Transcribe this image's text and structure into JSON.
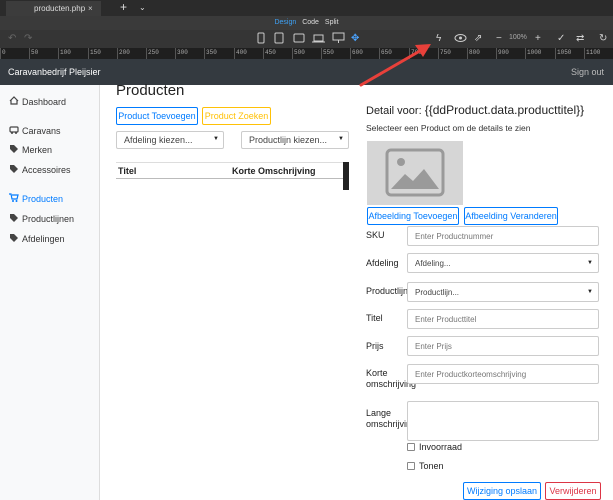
{
  "tabbar": {
    "tab_label": "producten.php",
    "close": "×",
    "add": "+",
    "chevron": "⌄"
  },
  "modebar": {
    "design": "Design",
    "code": "Code",
    "split": "Split"
  },
  "toolbar": {
    "zoom": "100%"
  },
  "ruler": {
    "labels": [
      "0",
      "50",
      "100",
      "150",
      "200",
      "250",
      "300",
      "350",
      "400",
      "450",
      "500",
      "550",
      "600",
      "650",
      "700",
      "750",
      "800",
      "900",
      "1000",
      "1050",
      "1100"
    ]
  },
  "navbar": {
    "brand": "Caravanbedrijf Pleijsier",
    "signout": "Sign out"
  },
  "sidebar": {
    "items": [
      {
        "label": "Dashboard",
        "icon": "home-icon"
      },
      {
        "label": "Caravans",
        "icon": "car-icon"
      },
      {
        "label": "Merken",
        "icon": "tag-icon"
      },
      {
        "label": "Accessoires",
        "icon": "tag-icon"
      },
      {
        "label": "Producten",
        "icon": "cart-icon",
        "active": true
      },
      {
        "label": "Productlijnen",
        "icon": "tag-icon"
      },
      {
        "label": "Afdelingen",
        "icon": "tag-icon"
      }
    ]
  },
  "main": {
    "title": "Producten",
    "add_button": "Product Toevoegen",
    "search_button": "Product Zoeken",
    "afdeling_select": "Afdeling kiezen...",
    "productlijn_select": "Productlijn kiezen...",
    "table": {
      "columns": [
        "Titel",
        "Korte Omschrijving"
      ]
    }
  },
  "detail": {
    "title_prefix": "Detail voor: ",
    "title_var": "{{ddProduct.data.producttitel}}",
    "subtitle": "Selecteer een Product om de details te zien",
    "add_image_button": "Afbeelding Toevoegen",
    "change_image_button": "Afbeelding Veranderen",
    "fields": {
      "sku": {
        "label": "SKU",
        "placeholder": "Enter Productnummer"
      },
      "afdeling": {
        "label": "Afdeling",
        "value": "Afdeling..."
      },
      "productlijn": {
        "label": "Productlijn",
        "value": "Productlijn..."
      },
      "titel": {
        "label": "Titel",
        "placeholder": "Enter Producttitel"
      },
      "prijs": {
        "label": "Prijs",
        "placeholder": "Enter Prijs"
      },
      "korte": {
        "label1": "Korte",
        "label2": "omschrijving",
        "placeholder": "Enter Productkorteomschrijving"
      },
      "lange": {
        "label1": "Lange",
        "label2": "omschrijving"
      }
    },
    "invoorraad": "Invoorraad",
    "tonen": "Tonen",
    "save_button": "Wijziging opslaan",
    "delete_button": "Verwijderen"
  },
  "colors": {
    "accent": "#007bff",
    "warning": "#ffc107",
    "danger": "#dc3545",
    "annotation_arrow": "#e8403a"
  }
}
